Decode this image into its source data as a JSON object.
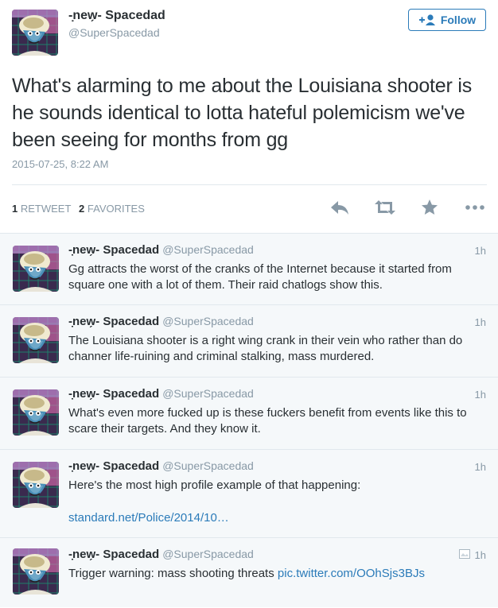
{
  "author": {
    "name": "-̣new̗- Spacedad",
    "handle": "@SuperSpacedad"
  },
  "follow": {
    "label": "Follow"
  },
  "tweet": {
    "text": "What's alarming to me about the Louisiana shooter is he sounds identical to lotta hateful polemicism we've been seeing for months from gg",
    "timestamp": "2015-07-25, 8:22 AM"
  },
  "stats": {
    "retweets_count": "1",
    "retweets_label": "RETWEET",
    "favorites_count": "2",
    "favorites_label": "FAVORITES"
  },
  "actions": [
    "reply-icon",
    "retweet-icon",
    "favorite-icon",
    "more-icon"
  ],
  "replies": [
    {
      "name": "-̣new̗- Spacedad",
      "handle": "@SuperSpacedad",
      "time": "1h",
      "text": "Gg attracts the worst of the cranks of the Internet because it started from square one with a lot of them. Their raid chatlogs show this."
    },
    {
      "name": "-̣new̗- Spacedad",
      "handle": "@SuperSpacedad",
      "time": "1h",
      "text": "The Louisiana shooter is a right wing crank in their vein who rather than do channer life-ruining and criminal stalking, mass murdered."
    },
    {
      "name": "-̣new̗- Spacedad",
      "handle": "@SuperSpacedad",
      "time": "1h",
      "text": "What's even more fucked up is these fuckers benefit from events like this to scare their targets. And they know it."
    },
    {
      "name": "-̣new̗- Spacedad",
      "handle": "@SuperSpacedad",
      "time": "1h",
      "text": "Here's the most high profile example of that happening:",
      "link": "standard.net/Police/2014/10…"
    },
    {
      "name": "-̣new̗- Spacedad",
      "handle": "@SuperSpacedad",
      "time": "1h",
      "text": "Trigger warning: mass shooting threats ",
      "link": "pic.twitter.com/OOhSjs3BJs",
      "media_icon": "photo-icon"
    }
  ],
  "colors": {
    "link": "#2b7bb9",
    "muted": "#8899a6",
    "text": "#292f33",
    "icon": "#8899a6",
    "reply_bg": "#f5f8fa"
  }
}
